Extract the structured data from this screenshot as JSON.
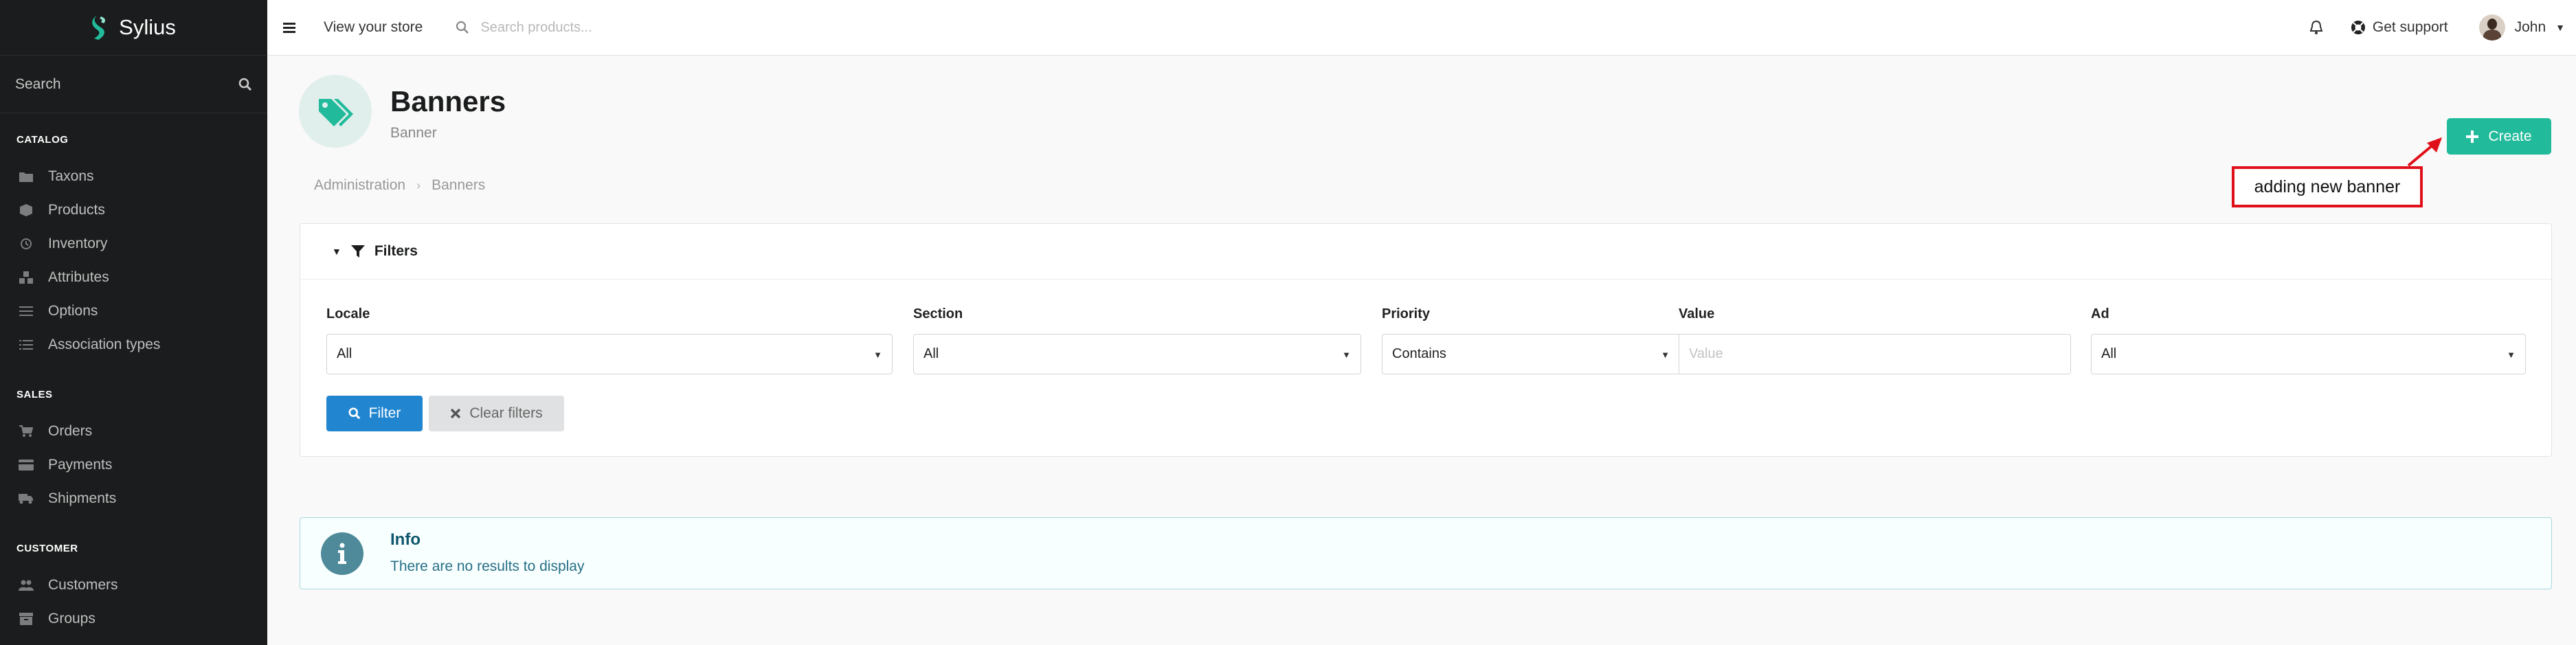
{
  "brand": {
    "name": "Sylius",
    "accent": "#21ba9b"
  },
  "sidebar": {
    "search_label": "Search",
    "sections": [
      {
        "title": "CATALOG",
        "items": [
          {
            "label": "Taxons",
            "icon": "folder-icon"
          },
          {
            "label": "Products",
            "icon": "cube-icon"
          },
          {
            "label": "Inventory",
            "icon": "history-icon"
          },
          {
            "label": "Attributes",
            "icon": "cubes-icon"
          },
          {
            "label": "Options",
            "icon": "sliders-icon"
          },
          {
            "label": "Association types",
            "icon": "list-icon"
          }
        ]
      },
      {
        "title": "SALES",
        "items": [
          {
            "label": "Orders",
            "icon": "cart-icon"
          },
          {
            "label": "Payments",
            "icon": "payment-icon"
          },
          {
            "label": "Shipments",
            "icon": "truck-icon"
          }
        ]
      },
      {
        "title": "CUSTOMER",
        "items": [
          {
            "label": "Customers",
            "icon": "users-icon"
          },
          {
            "label": "Groups",
            "icon": "archive-icon"
          }
        ]
      }
    ]
  },
  "topbar": {
    "view_store": "View your store",
    "search_placeholder": "Search products...",
    "support": "Get support",
    "user_name": "John"
  },
  "header": {
    "title": "Banners",
    "subtitle": "Banner",
    "breadcrumb": [
      "Administration",
      "Banners"
    ],
    "create_label": "Create"
  },
  "annotation": {
    "text": "adding new banner",
    "color": "#e0101a"
  },
  "filters": {
    "title": "Filters",
    "fields": {
      "locale": {
        "label": "Locale",
        "value": "All"
      },
      "section": {
        "label": "Section",
        "value": "All"
      },
      "priority": {
        "label": "Priority",
        "value": "Contains"
      },
      "value": {
        "label": "Value",
        "placeholder": "Value"
      },
      "ad": {
        "label": "Ad",
        "value": "All"
      }
    },
    "filter_button": "Filter",
    "clear_button": "Clear filters"
  },
  "info": {
    "title": "Info",
    "text": "There are no results to display"
  }
}
